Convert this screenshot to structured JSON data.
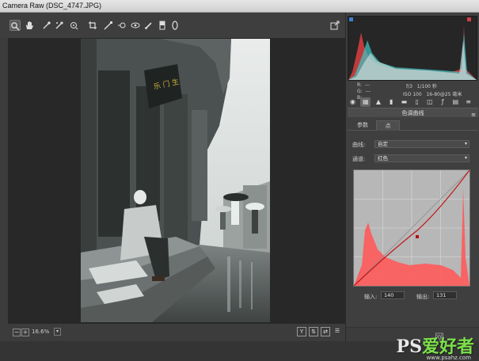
{
  "window": {
    "title": "Camera Raw (DSC_4747.JPG)"
  },
  "toolbar": {
    "tools": [
      "zoom-tool",
      "hand-tool",
      "white-balance-tool",
      "color-sampler-tool",
      "target-adjustment-tool",
      "crop-tool",
      "straighten-tool",
      "spot-removal-tool",
      "red-eye-tool",
      "adjustment-brush",
      "graduated-filter",
      "radial-filter"
    ],
    "open_preferences": "↗"
  },
  "status": {
    "zoom_value": "16.6%",
    "minus": "−",
    "plus": "+"
  },
  "histogram": {
    "r_label": "R:",
    "g_label": "G:",
    "b_label": "B:",
    "r_value": "---",
    "g_value": "---",
    "b_value": "---",
    "aperture": "f/3",
    "shutter": "1/100 秒",
    "iso": "ISO 100",
    "lens": "16-80@25 毫米"
  },
  "panel": {
    "title": "色调曲线",
    "menu_icon": "≡",
    "tabs": [
      {
        "label": "参数"
      },
      {
        "label": "点"
      }
    ],
    "curve_label": "曲线:",
    "curve_value": "自定",
    "channel_label": "通道:",
    "channel_value": "红色",
    "input_label": "输入:",
    "input_value": "140",
    "output_label": "输出:",
    "output_value": "131"
  },
  "watermark": {
    "logo_ps": "PS",
    "logo_cn": "爱好者",
    "url": "www.psahz.com",
    "faint": "网"
  },
  "colors": {
    "accent_red": "#ff4a4a",
    "curve_line": "#c01818",
    "ui_bg": "#3f3f3f"
  }
}
